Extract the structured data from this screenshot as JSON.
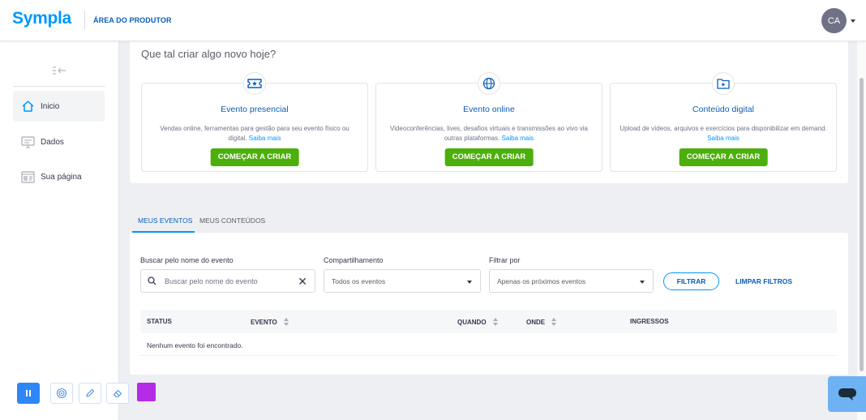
{
  "header": {
    "logo": "Sympla",
    "area": "ÁREA DO PRODUTOR",
    "avatar_initials": "CA"
  },
  "sidebar": {
    "items": [
      {
        "label": "Inicio",
        "icon": "home-icon",
        "active": true
      },
      {
        "label": "Dados",
        "icon": "monitor-icon",
        "active": false
      },
      {
        "label": "Sua página",
        "icon": "webpage-icon",
        "active": false
      }
    ]
  },
  "create": {
    "title": "Que tal criar algo novo hoje?",
    "cards": [
      {
        "title": "Evento presencial",
        "icon": "ticket-icon",
        "desc": "Vendas online, ferramentas para gestão para seu evento físico ou digital.",
        "link": "Saiba mais",
        "button": "COMEÇAR A CRIAR"
      },
      {
        "title": "Evento online",
        "icon": "globe-icon",
        "desc": "Videoconferências, lives, desafios virtuais e transmissões ao vivo via outras plataformas.",
        "link": "Saiba mais",
        "button": "COMEÇAR A CRIAR"
      },
      {
        "title": "Conteúdo digital",
        "icon": "play-folder-icon",
        "desc": "Upload de vídeos, arquivos e exercícios para disponibilizar em demand.",
        "link": "Saiba mais",
        "button": "COMEÇAR A CRIAR"
      }
    ]
  },
  "tabs": [
    {
      "label": "MEUS EVENTOS",
      "active": true
    },
    {
      "label": "MEUS CONTEÚDOS",
      "active": false
    }
  ],
  "filters": {
    "search_label": "Buscar pelo nome do evento",
    "search_placeholder": "Buscar pelo nome do evento",
    "share_label": "Compartilhamento",
    "share_value": "Todos os eventos",
    "filter_label": "Filtrar por",
    "filter_value": "Apenas os próximos eventos",
    "filter_button": "FILTRAR",
    "clear_button": "LIMPAR FILTROS"
  },
  "table": {
    "columns": [
      "STATUS",
      "EVENTO",
      "QUANDO",
      "ONDE",
      "INGRESSOS"
    ],
    "empty_message": "Nenhum evento foi encontrado."
  },
  "toolbar": {
    "tools": [
      "pause-icon",
      "target-icon",
      "pencil-icon",
      "eraser-icon"
    ],
    "color": "#b42be6"
  },
  "colors": {
    "brand": "#0097ff",
    "primary_button": "#4caf0c",
    "link": "#0b5db9"
  }
}
